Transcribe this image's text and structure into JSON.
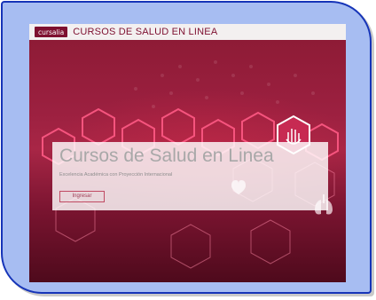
{
  "header": {
    "logo_text": "cursalia",
    "site_title": "CURSOS DE SALUD EN LINEA"
  },
  "hero": {
    "title": "Cursos de Salud en Linea",
    "subtitle": "Excelencia Académica con Proyección Internacional",
    "button_label": "Ingresar"
  },
  "colors": {
    "brand": "#7e1030",
    "background": "#9c2040",
    "frame": "#a7bdf2",
    "frame_border": "#1634b8"
  },
  "icons": [
    "hand-hexagon-icon",
    "lungs-icon",
    "heart-icon"
  ]
}
